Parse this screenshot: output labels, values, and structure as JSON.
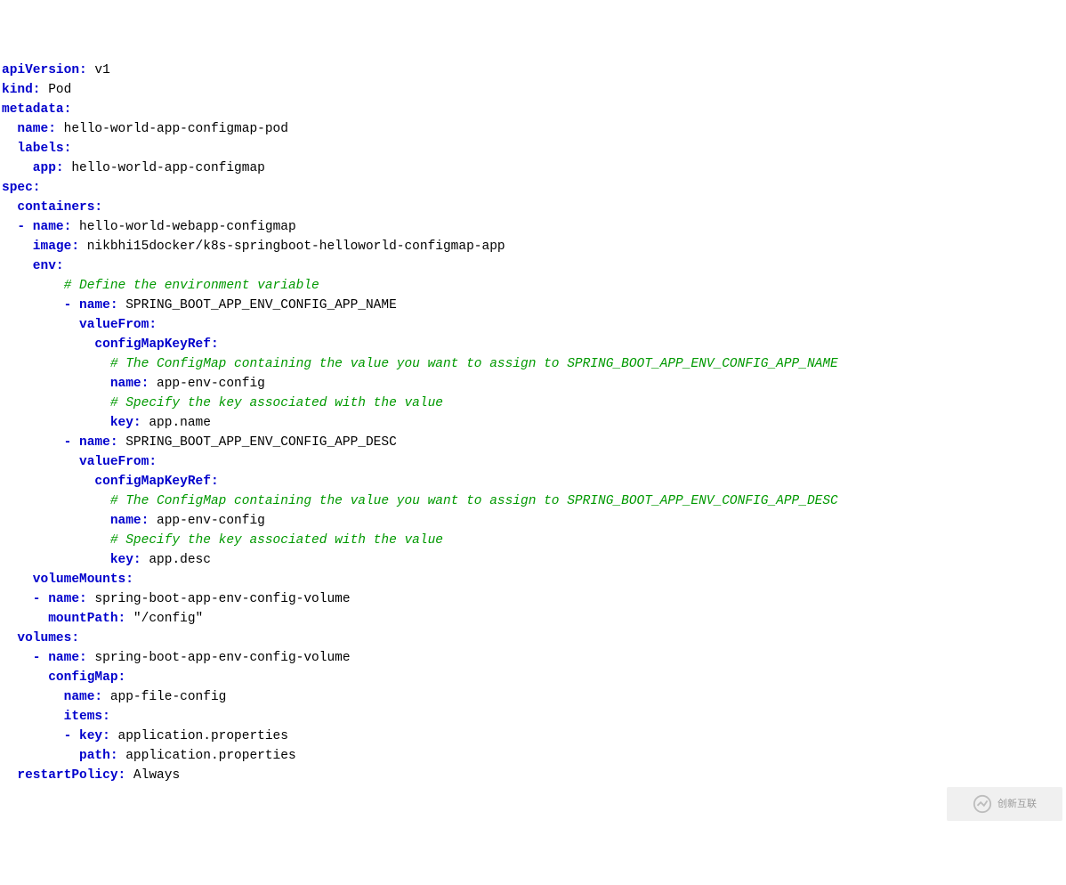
{
  "yaml": {
    "apiVersion_key": "apiVersion:",
    "apiVersion_val": " v1",
    "kind_key": "kind:",
    "kind_val": " Pod",
    "metadata_key": "metadata:",
    "metadata_name_key": "  name:",
    "metadata_name_val": " hello-world-app-configmap-pod",
    "labels_key": "  labels:",
    "labels_app_key": "    app:",
    "labels_app_val": " hello-world-app-configmap",
    "spec_key": "spec:",
    "containers_key": "  containers:",
    "c0_name_key": "  - name:",
    "c0_name_val": " hello-world-webapp-configmap",
    "c0_image_key": "    image:",
    "c0_image_val": " nikbhi15docker/k8s-springboot-helloworld-configmap-app",
    "c0_env_key": "    env:",
    "c0_env_comment1": "        # Define the environment variable",
    "c0_env0_name_key": "        - name:",
    "c0_env0_name_val": " SPRING_BOOT_APP_ENV_CONFIG_APP_NAME",
    "c0_env0_vf_key": "          valueFrom:",
    "c0_env0_cmk_key": "            configMapKeyRef:",
    "c0_env0_comment_cm": "              # The ConfigMap containing the value you want to assign to SPRING_BOOT_APP_ENV_CONFIG_APP_NAME",
    "c0_env0_cm_name_key": "              name:",
    "c0_env0_cm_name_val": " app-env-config",
    "c0_env0_comment_key": "              # Specify the key associated with the value",
    "c0_env0_cm_key_key": "              key:",
    "c0_env0_cm_key_val": " app.name",
    "c0_env1_name_key": "        - name:",
    "c0_env1_name_val": " SPRING_BOOT_APP_ENV_CONFIG_APP_DESC",
    "c0_env1_vf_key": "          valueFrom:",
    "c0_env1_cmk_key": "            configMapKeyRef:",
    "c0_env1_comment_cm": "              # The ConfigMap containing the value you want to assign to SPRING_BOOT_APP_ENV_CONFIG_APP_DESC",
    "c0_env1_cm_name_key": "              name:",
    "c0_env1_cm_name_val": " app-env-config",
    "c0_env1_comment_key": "              # Specify the key associated with the value",
    "c0_env1_cm_key_key": "              key:",
    "c0_env1_cm_key_val": " app.desc",
    "c0_vm_key": "    volumeMounts:",
    "c0_vm0_name_key": "    - name:",
    "c0_vm0_name_val": " spring-boot-app-env-config-volume",
    "c0_vm0_mp_key": "      mountPath:",
    "c0_vm0_mp_val": " \"/config\"",
    "vol_key": "  volumes:",
    "vol0_name_key": "    - name:",
    "vol0_name_val": " spring-boot-app-env-config-volume",
    "vol0_cm_key": "      configMap:",
    "vol0_cm_name_key": "        name:",
    "vol0_cm_name_val": " app-file-config",
    "vol0_items_key": "        items:",
    "vol0_item0_key_key": "        - key:",
    "vol0_item0_key_val": " application.properties",
    "vol0_item0_path_key": "          path:",
    "vol0_item0_path_val": " application.properties",
    "restart_key": "  restartPolicy:",
    "restart_val": " Always"
  },
  "watermark": "创新互联"
}
